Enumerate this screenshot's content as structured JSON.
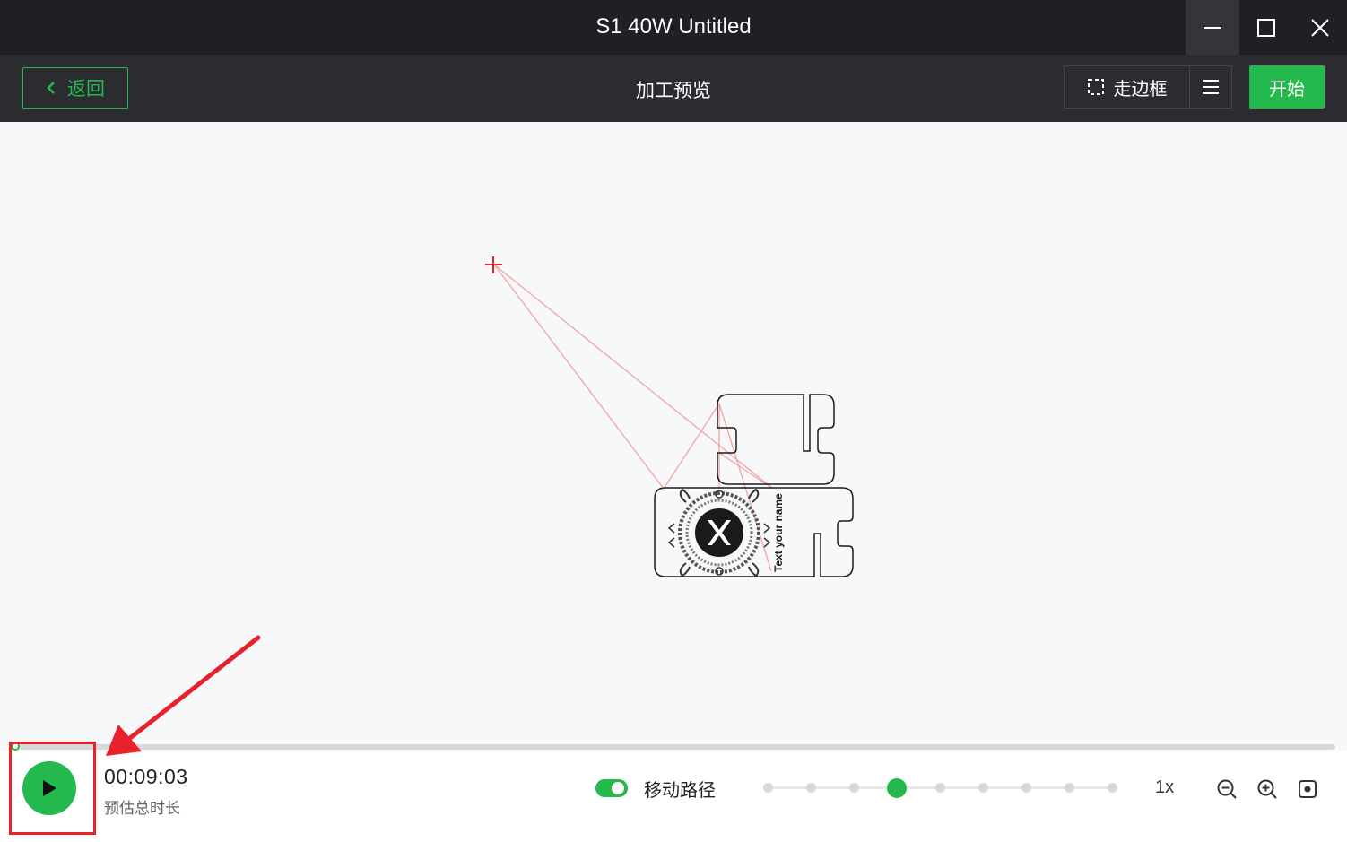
{
  "window": {
    "title": "S1 40W Untitled"
  },
  "toolbar": {
    "back_label": "返回",
    "page_title": "加工预览",
    "frame_label": "走边框",
    "start_label": "开始"
  },
  "design": {
    "engraved_text": "Text your name"
  },
  "playback": {
    "time": "00:09:03",
    "time_label": "预估总时长",
    "move_path_label": "移动路径",
    "move_path_enabled": true,
    "speed": "1x",
    "speed_steps": 9,
    "speed_selected_index": 3
  },
  "icons": {
    "back": "chevron-left-icon",
    "frame": "dashed-square-icon",
    "menu": "hamburger-menu-icon",
    "play": "play-icon",
    "zoom_out": "zoom-out-icon",
    "zoom_in": "zoom-in-icon",
    "fit": "fit-view-icon"
  },
  "colors": {
    "accent": "#23b94c",
    "titlebar": "#1f2023",
    "toolbar": "#2b2c30",
    "path": "#f4a3a3",
    "annotation": "#e8222a"
  }
}
